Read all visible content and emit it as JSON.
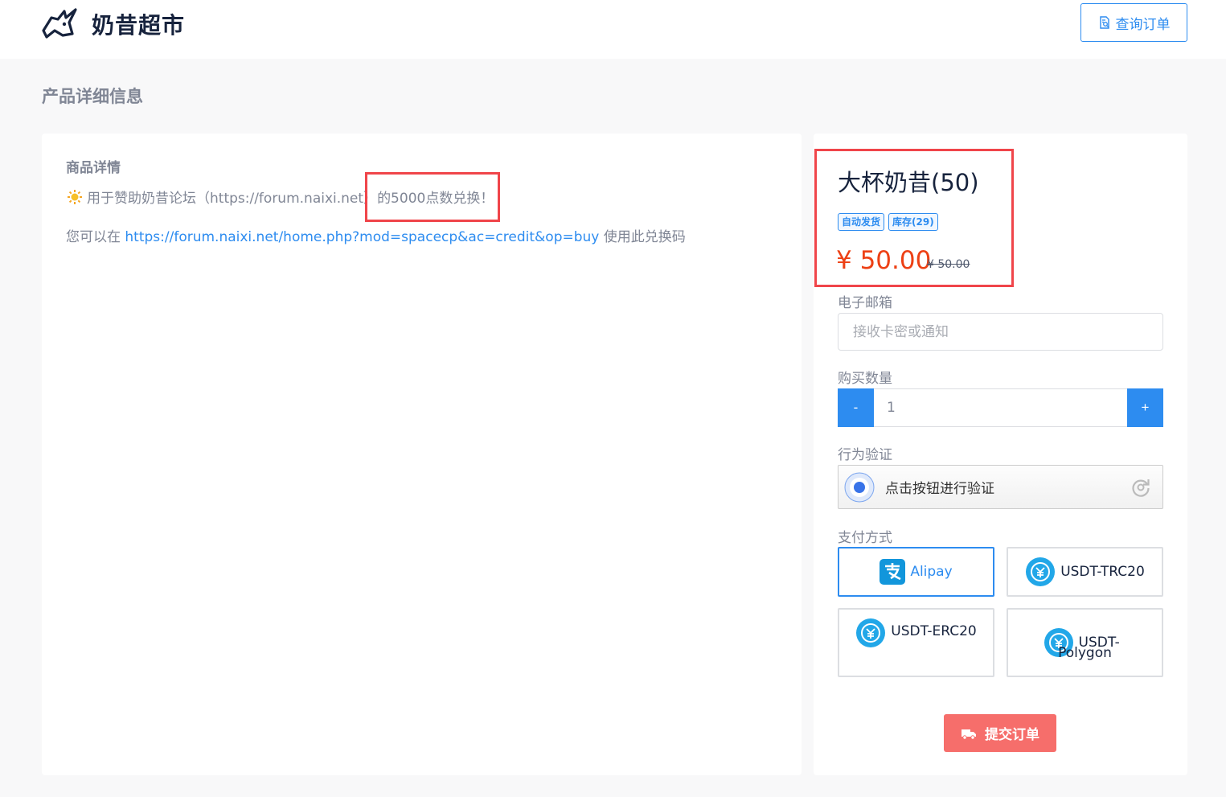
{
  "header": {
    "site_title": "奶昔超市",
    "query_button_label": "查询订单",
    "logo_icon": "unicorn-logo-icon"
  },
  "page": {
    "heading": "产品详细信息"
  },
  "details": {
    "section_title": "商品详情",
    "line1_prefix": "用于赞助奶昔论坛（https://forum.naixi.net）",
    "line1_highlight": "的5000点数兑换！",
    "line2_prefix": "您可以在 ",
    "line2_link": "https://forum.naixi.net/home.php?mod=spacecp&ac=credit&op=buy",
    "line2_suffix": " 使用此兑换码"
  },
  "product": {
    "name": "大杯奶昔(50)",
    "badge_auto": "自动发货",
    "badge_stock": "库存(29)",
    "price": "¥ 50.00",
    "old_price": "¥ 50.00"
  },
  "form": {
    "email_label": "电子邮箱",
    "email_placeholder": "接收卡密或通知",
    "qty_label": "购买数量",
    "qty_minus": "-",
    "qty_plus": "+",
    "qty_value": "1",
    "captcha_label": "行为验证",
    "captcha_text": "点击按钮进行验证",
    "payment_label": "支付方式",
    "payments": [
      {
        "label": "Alipay",
        "selected": true
      },
      {
        "label": "USDT-TRC20"
      },
      {
        "label": "USDT-ERC20"
      },
      {
        "label": "USDT-Polygon"
      }
    ],
    "submit_label": "提交订单"
  },
  "colors": {
    "accent": "#2d8cf0",
    "price": "#ed4014",
    "submit": "#f66e6b",
    "highlight": "#f0454a"
  }
}
